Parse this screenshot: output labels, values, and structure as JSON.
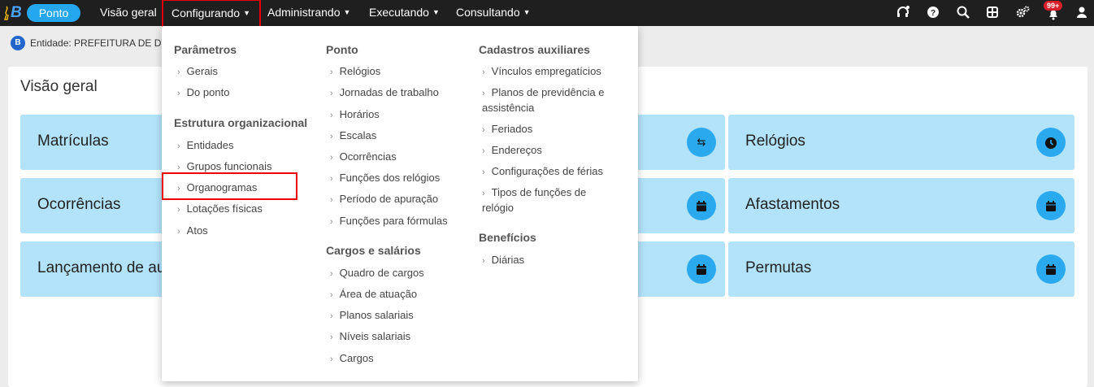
{
  "app": {
    "logo_letter": "B",
    "module": "Ponto"
  },
  "nav": {
    "items": [
      {
        "label": "Visão geral"
      },
      {
        "label": "Configurando"
      },
      {
        "label": "Administrando"
      },
      {
        "label": "Executando"
      },
      {
        "label": "Consultando"
      }
    ],
    "notification_count": "99+"
  },
  "entity": {
    "badge": "B",
    "text": "Entidade: PREFEITURA DE D"
  },
  "main": {
    "title": "Visão geral",
    "cards": [
      {
        "title": "Matrículas",
        "icon": "exchange-icon"
      },
      {
        "title": "Relógios",
        "icon": "clock-icon"
      },
      {
        "title": "Ocorrências",
        "icon": "calendar-icon"
      },
      {
        "title": "Afastamentos",
        "icon": "calendar-icon"
      },
      {
        "title": "Lançamento de au",
        "icon": "calendar-icon"
      },
      {
        "title": "Permutas",
        "icon": "calendar-icon"
      }
    ]
  },
  "menu": {
    "col1": {
      "sections": [
        {
          "title": "Parâmetros",
          "items": [
            "Gerais",
            "Do ponto"
          ]
        },
        {
          "title": "Estrutura organizacional",
          "items": [
            "Entidades",
            "Grupos funcionais",
            "Organogramas",
            "Lotações físicas",
            "Atos"
          ]
        }
      ]
    },
    "col2": {
      "sections": [
        {
          "title": "Ponto",
          "items": [
            "Relógios",
            "Jornadas de trabalho",
            "Horários",
            "Escalas",
            "Ocorrências",
            "Funções dos relógios",
            "Período de apuração",
            "Funções para fórmulas"
          ]
        },
        {
          "title": "Cargos e salários",
          "items": [
            "Quadro de cargos",
            "Área de atuação",
            "Planos salariais",
            "Níveis salariais",
            "Cargos"
          ]
        }
      ]
    },
    "col3": {
      "sections": [
        {
          "title": "Cadastros auxiliares",
          "items": [
            "Vínculos empregatícios",
            "Planos de previdência e",
            "assistência",
            "Feriados",
            "Endereços",
            "Configurações de férias",
            "Tipos de funções de",
            "relógio"
          ]
        },
        {
          "title": "Benefícios",
          "items": [
            "Diárias"
          ]
        }
      ]
    }
  }
}
